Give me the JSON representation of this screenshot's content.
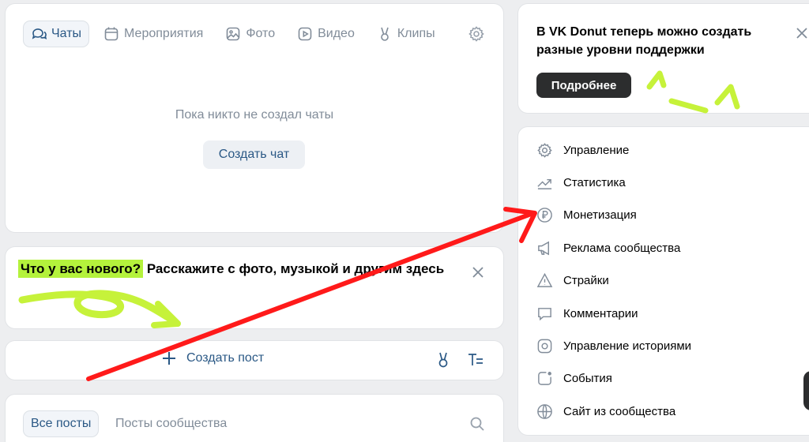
{
  "chats_tabs": [
    {
      "label": "Чаты",
      "icon": "chat-bubbles-icon",
      "active": true
    },
    {
      "label": "Мероприятия",
      "icon": "calendar-icon",
      "active": false
    },
    {
      "label": "Фото",
      "icon": "photo-icon",
      "active": false
    },
    {
      "label": "Видео",
      "icon": "video-play-icon",
      "active": false
    },
    {
      "label": "Клипы",
      "icon": "clips-icon",
      "active": false
    }
  ],
  "chats": {
    "empty_text": "Пока никто не создал чаты",
    "create_label": "Создать чат"
  },
  "whats_new": {
    "highlight": "Что у вас нового?",
    "text": " Расскажите с фото, музыкой и другим здесь"
  },
  "create_post": {
    "label": "Создать пост"
  },
  "posts_tabs": {
    "all": "Все посты",
    "community": "Посты сообщества"
  },
  "donut": {
    "title": "В VK Donut теперь можно создать разные уровни поддержки",
    "button": "Подробнее"
  },
  "menu": [
    {
      "label": "Управление",
      "icon": "gear-icon"
    },
    {
      "label": "Статистика",
      "icon": "trend-chart-icon"
    },
    {
      "label": "Монетизация",
      "icon": "ruble-icon"
    },
    {
      "label": "Реклама сообщества",
      "icon": "megaphone-icon"
    },
    {
      "label": "Страйки",
      "icon": "warning-icon"
    },
    {
      "label": "Комментарии",
      "icon": "comment-icon"
    },
    {
      "label": "Управление историями",
      "icon": "stories-icon"
    },
    {
      "label": "События",
      "icon": "events-icon"
    },
    {
      "label": "Сайт из сообщества",
      "icon": "globe-icon"
    }
  ],
  "colors": {
    "accent": "#2a5885",
    "highlight": "#b4f23c",
    "annotation_red": "#ff1a1a",
    "annotation_green": "#c6f23a"
  }
}
